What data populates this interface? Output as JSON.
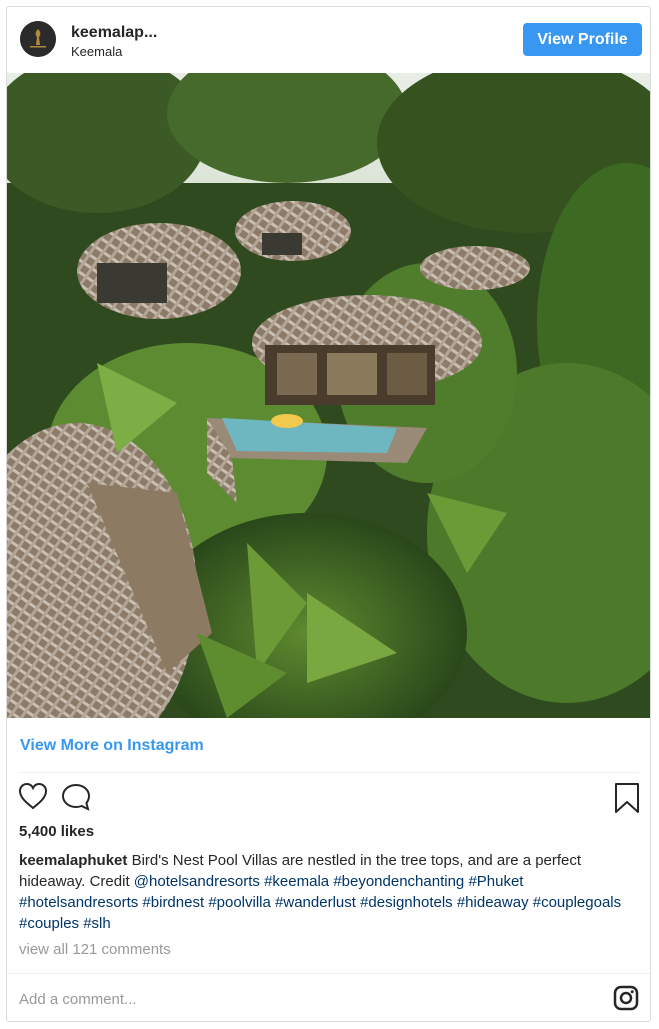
{
  "header": {
    "username": "keemalap...",
    "fullname": "Keemala",
    "view_profile_label": "View Profile"
  },
  "photo": {
    "description_icon": "photo"
  },
  "view_more_label": "View More on Instagram",
  "actions": {
    "like_icon": "heart-icon",
    "comment_icon": "comment-icon",
    "save_icon": "bookmark-icon"
  },
  "likes_text": "5,400 likes",
  "caption": {
    "username": "keemalaphuket",
    "text": "Bird's Nest Pool Villas are nestled in the tree tops, and are a perfect hideaway. Credit",
    "mention": "@hotelsandresorts",
    "hashtags": [
      "#keemala",
      "#beyondenchanting",
      "#Phuket",
      "#hotelsandresorts",
      "#birdnest",
      "#poolvilla",
      "#wanderlust",
      "#designhotels",
      "#hideaway",
      "#couplegoals",
      "#couples",
      "#slh"
    ]
  },
  "view_comments_label": "view all 121 comments",
  "add_comment_placeholder": "Add a comment...",
  "colors": {
    "accent": "#3897f0",
    "hashtag": "#003569",
    "muted": "#999999"
  }
}
